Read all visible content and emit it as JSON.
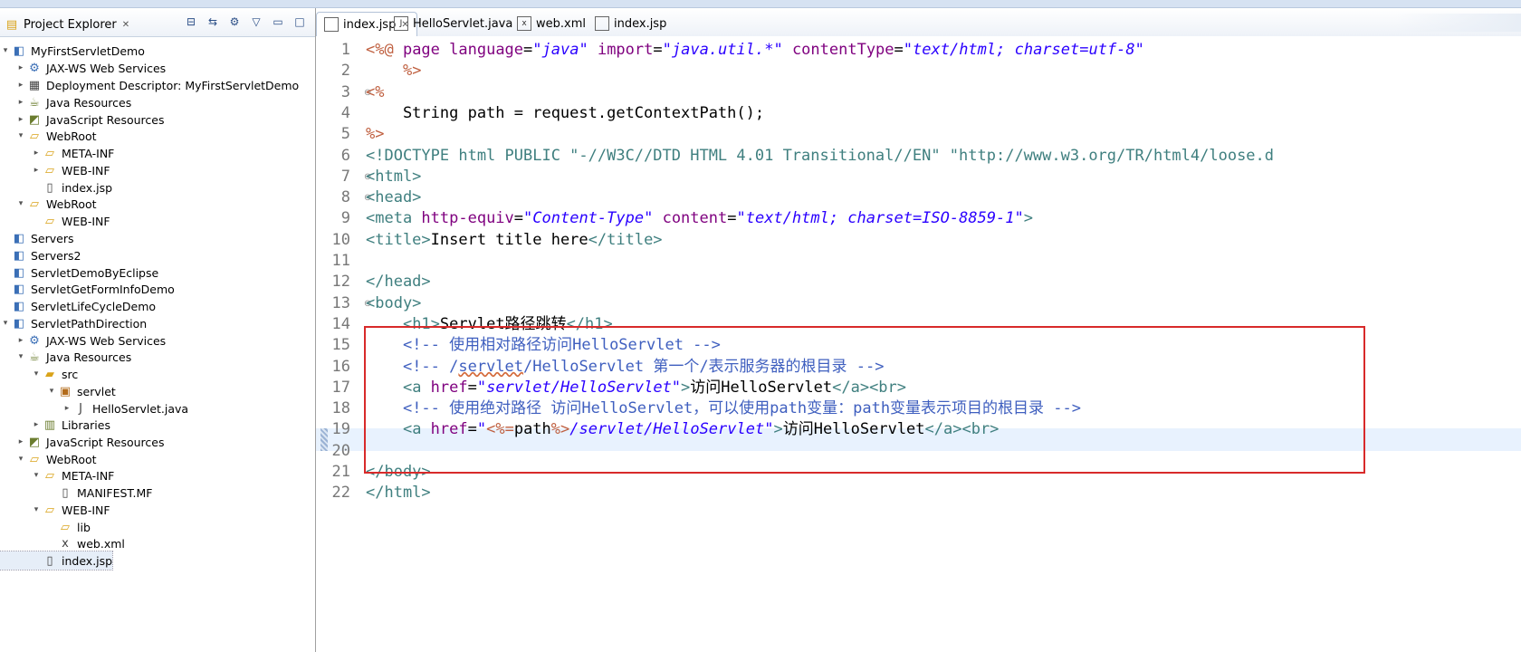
{
  "explorer": {
    "title": "Project Explorer",
    "items": [
      {
        "label": "MyFirstServletDemo",
        "depth": 0,
        "arrow": "▾",
        "icon": "project-icon"
      },
      {
        "label": "JAX-WS Web Services",
        "depth": 1,
        "arrow": "▸",
        "icon": "webservices-icon"
      },
      {
        "label": "Deployment Descriptor: MyFirstServletDemo",
        "depth": 1,
        "arrow": "▸",
        "icon": "descriptor-icon"
      },
      {
        "label": "Java Resources",
        "depth": 1,
        "arrow": "▸",
        "icon": "java-resources-icon"
      },
      {
        "label": "JavaScript Resources",
        "depth": 1,
        "arrow": "▸",
        "icon": "js-resources-icon"
      },
      {
        "label": "WebRoot",
        "depth": 1,
        "arrow": "▾",
        "icon": "folder-icon"
      },
      {
        "label": "META-INF",
        "depth": 2,
        "arrow": "▸",
        "icon": "folder-icon"
      },
      {
        "label": "WEB-INF",
        "depth": 2,
        "arrow": "▸",
        "icon": "folder-icon"
      },
      {
        "label": "index.jsp",
        "depth": 2,
        "arrow": "",
        "icon": "jsp-file-icon"
      },
      {
        "label": "WebRoot",
        "depth": 1,
        "arrow": "▾",
        "icon": "folder-icon"
      },
      {
        "label": "WEB-INF",
        "depth": 2,
        "arrow": "",
        "icon": "folder-icon"
      },
      {
        "label": "Servers",
        "depth": 0,
        "arrow": "",
        "icon": "project-icon"
      },
      {
        "label": "Servers2",
        "depth": 0,
        "arrow": "",
        "icon": "project-icon"
      },
      {
        "label": "ServletDemoByEclipse",
        "depth": 0,
        "arrow": "",
        "icon": "project-icon"
      },
      {
        "label": "ServletGetFormInfoDemo",
        "depth": 0,
        "arrow": "",
        "icon": "project-icon"
      },
      {
        "label": "ServletLifeCycleDemo",
        "depth": 0,
        "arrow": "",
        "icon": "project-icon"
      },
      {
        "label": "ServletPathDirection",
        "depth": 0,
        "arrow": "▾",
        "icon": "project-icon"
      },
      {
        "label": "JAX-WS Web Services",
        "depth": 1,
        "arrow": "▸",
        "icon": "webservices-icon"
      },
      {
        "label": "Java Resources",
        "depth": 1,
        "arrow": "▾",
        "icon": "java-resources-icon"
      },
      {
        "label": "src",
        "depth": 2,
        "arrow": "▾",
        "icon": "source-folder-icon"
      },
      {
        "label": "servlet",
        "depth": 3,
        "arrow": "▾",
        "icon": "package-icon"
      },
      {
        "label": "HelloServlet.java",
        "depth": 4,
        "arrow": "▸",
        "icon": "java-file-icon"
      },
      {
        "label": "Libraries",
        "depth": 2,
        "arrow": "▸",
        "icon": "libraries-icon"
      },
      {
        "label": "JavaScript Resources",
        "depth": 1,
        "arrow": "▸",
        "icon": "js-resources-icon"
      },
      {
        "label": "WebRoot",
        "depth": 1,
        "arrow": "▾",
        "icon": "folder-icon"
      },
      {
        "label": "META-INF",
        "depth": 2,
        "arrow": "▾",
        "icon": "folder-icon"
      },
      {
        "label": "MANIFEST.MF",
        "depth": 3,
        "arrow": "",
        "icon": "file-icon"
      },
      {
        "label": "WEB-INF",
        "depth": 2,
        "arrow": "▾",
        "icon": "folder-icon"
      },
      {
        "label": "lib",
        "depth": 3,
        "arrow": "",
        "icon": "folder-icon"
      },
      {
        "label": "web.xml",
        "depth": 3,
        "arrow": "",
        "icon": "xml-file-icon"
      },
      {
        "label": "index.jsp",
        "depth": 2,
        "arrow": "",
        "icon": "jsp-file-icon"
      }
    ]
  },
  "editor": {
    "tabs": [
      {
        "label": "index.jsp",
        "active": true,
        "icon": "jsp-file-icon"
      },
      {
        "label": "HelloServlet.java",
        "active": false,
        "icon": "java-file-icon"
      },
      {
        "label": "web.xml",
        "active": false,
        "icon": "xml-file-icon"
      },
      {
        "label": "index.jsp",
        "active": false,
        "icon": "jsp-file-icon"
      }
    ],
    "lines": [
      {
        "n": "1",
        "fold": "",
        "segs": [
          [
            "jsp",
            "<%@ "
          ],
          [
            "attr",
            "page "
          ],
          [
            "attr",
            "language"
          ],
          [
            "plain",
            "="
          ],
          [
            "str",
            "\"java\""
          ],
          [
            "plain",
            " "
          ],
          [
            "attr",
            "import"
          ],
          [
            "plain",
            "="
          ],
          [
            "str",
            "\"java.util.*\""
          ],
          [
            "plain",
            " "
          ],
          [
            "attr",
            "contentType"
          ],
          [
            "plain",
            "="
          ],
          [
            "str",
            "\"text/html; charset=utf-8\""
          ]
        ]
      },
      {
        "n": "2",
        "fold": "",
        "segs": [
          [
            "plain",
            "    "
          ],
          [
            "jsp",
            "%>"
          ]
        ]
      },
      {
        "n": "3",
        "fold": "⊖",
        "segs": [
          [
            "jsp",
            "<%"
          ]
        ]
      },
      {
        "n": "4",
        "fold": "",
        "segs": [
          [
            "plain",
            "    String path = request.getContextPath();"
          ]
        ]
      },
      {
        "n": "5",
        "fold": "",
        "segs": [
          [
            "jsp",
            "%>"
          ]
        ]
      },
      {
        "n": "6",
        "fold": "",
        "segs": [
          [
            "tag",
            "<!DOCTYPE html PUBLIC \"-//W3C//DTD HTML 4.01 Transitional//EN\" \"http://www.w3.org/TR/html4/loose.d"
          ]
        ]
      },
      {
        "n": "7",
        "fold": "⊖",
        "segs": [
          [
            "tag",
            "<html>"
          ]
        ]
      },
      {
        "n": "8",
        "fold": "⊖",
        "segs": [
          [
            "tag",
            "<head>"
          ]
        ]
      },
      {
        "n": "9",
        "fold": "",
        "segs": [
          [
            "tag",
            "<meta "
          ],
          [
            "attr",
            "http-equiv"
          ],
          [
            "plain",
            "="
          ],
          [
            "str",
            "\"Content-Type\""
          ],
          [
            "plain",
            " "
          ],
          [
            "attr",
            "content"
          ],
          [
            "plain",
            "="
          ],
          [
            "str",
            "\"text/html; charset=ISO-8859-1\""
          ],
          [
            "tag",
            ">"
          ]
        ]
      },
      {
        "n": "10",
        "fold": "",
        "segs": [
          [
            "tag",
            "<title>"
          ],
          [
            "plain",
            "Insert title here"
          ],
          [
            "tag",
            "</title>"
          ]
        ]
      },
      {
        "n": "11",
        "fold": "",
        "segs": []
      },
      {
        "n": "12",
        "fold": "",
        "segs": [
          [
            "tag",
            "</head>"
          ]
        ]
      },
      {
        "n": "13",
        "fold": "⊖",
        "segs": [
          [
            "tag",
            "<body>"
          ]
        ]
      },
      {
        "n": "14",
        "fold": "",
        "segs": [
          [
            "plain",
            "    "
          ],
          [
            "tag",
            "<h1>"
          ],
          [
            "plain",
            "Servlet路径跳转"
          ],
          [
            "tag",
            "</h1>"
          ]
        ]
      },
      {
        "n": "15",
        "fold": "",
        "segs": [
          [
            "plain",
            "    "
          ],
          [
            "cmt",
            "<!-- 使用相对路径访问HelloServlet -->"
          ]
        ]
      },
      {
        "n": "16",
        "fold": "",
        "segs": [
          [
            "plain",
            "    "
          ],
          [
            "cmt",
            "<!-- /"
          ],
          [
            "cmt-sq",
            "servlet"
          ],
          [
            "cmt",
            "/HelloServlet 第一个/表示服务器的根目录 -->"
          ]
        ]
      },
      {
        "n": "17",
        "fold": "",
        "segs": [
          [
            "plain",
            "    "
          ],
          [
            "tag",
            "<a "
          ],
          [
            "attr",
            "href"
          ],
          [
            "plain",
            "="
          ],
          [
            "str",
            "\"servlet/HelloServlet\""
          ],
          [
            "tag",
            ">"
          ],
          [
            "plain",
            "访问HelloServlet"
          ],
          [
            "tag",
            "</a><br>"
          ]
        ]
      },
      {
        "n": "18",
        "fold": "",
        "segs": [
          [
            "plain",
            "    "
          ],
          [
            "cmt",
            "<!-- 使用绝对路径 访问HelloServlet，可以使用path变量：path变量表示项目的根目录 -->"
          ]
        ]
      },
      {
        "n": "19",
        "fold": "",
        "segs": [
          [
            "plain",
            "    "
          ],
          [
            "tag",
            "<a "
          ],
          [
            "attr",
            "href"
          ],
          [
            "plain",
            "="
          ],
          [
            "str",
            "\""
          ],
          [
            "jsp",
            "<%="
          ],
          [
            "plain",
            "path"
          ],
          [
            "jsp",
            "%>"
          ],
          [
            "str",
            "/servlet/HelloServlet\""
          ],
          [
            "tag",
            ">"
          ],
          [
            "plain",
            "访问HelloServlet"
          ],
          [
            "tag",
            "</a><br>"
          ]
        ]
      },
      {
        "n": "20",
        "fold": "",
        "segs": []
      },
      {
        "n": "21",
        "fold": "",
        "segs": [
          [
            "tag",
            "</body>"
          ]
        ]
      },
      {
        "n": "22",
        "fold": "",
        "segs": [
          [
            "tag",
            "</html>"
          ]
        ]
      }
    ]
  },
  "colors": {
    "highlight_box": "#d82a2a",
    "current_line": "#e8f2fe"
  }
}
